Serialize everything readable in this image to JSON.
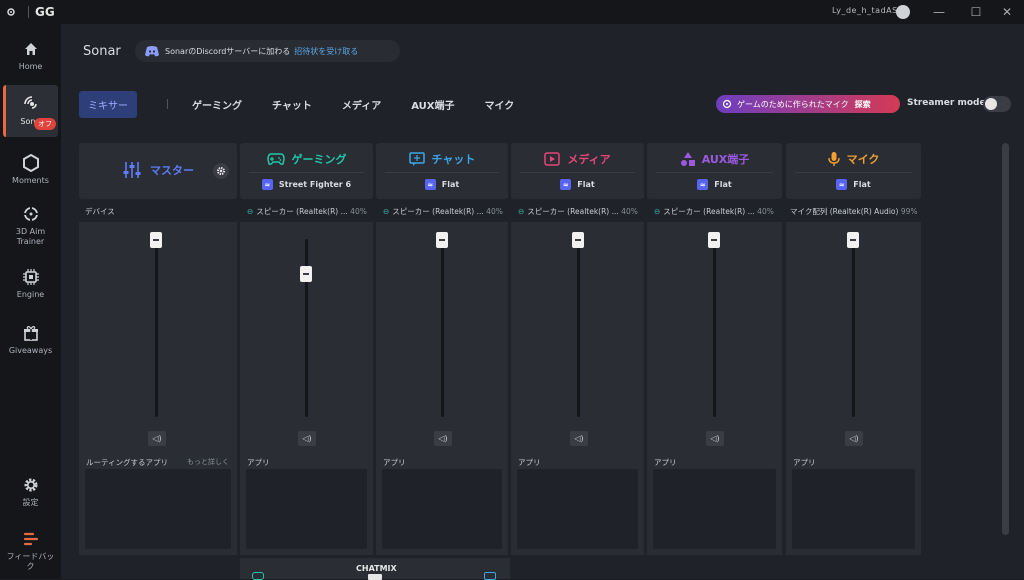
{
  "titlebar": {
    "app": "GG",
    "user": "Ly_de_h_tadAS"
  },
  "sidebar": {
    "items": [
      {
        "label": "Home",
        "icon": "home-icon"
      },
      {
        "label": "Sonar",
        "icon": "sonar-icon"
      },
      {
        "label": "Moments",
        "icon": "moments-icon"
      },
      {
        "label": "3D Aim Trainer",
        "icon": "aim-trainer-icon"
      },
      {
        "label": "Engine",
        "icon": "engine-icon"
      },
      {
        "label": "Giveaways",
        "icon": "gift-icon"
      },
      {
        "label": "設定",
        "icon": "gear-icon"
      },
      {
        "label": "フィードバック",
        "icon": "feedback-icon"
      }
    ],
    "moments_badge": "オフ"
  },
  "header": {
    "title": "Sonar",
    "discord_text": "SonarのDiscordサーバーに加わる",
    "discord_link": "招待状を受け取る"
  },
  "tabs": [
    {
      "label": "ミキサー"
    },
    {
      "label": "ゲーミング"
    },
    {
      "label": "チャット"
    },
    {
      "label": "メディア"
    },
    {
      "label": "AUX端子"
    },
    {
      "label": "マイク"
    }
  ],
  "explore": {
    "text": "ゲームのために作られたマイク",
    "action": "探索"
  },
  "streamer_mode": {
    "label": "Streamer mode",
    "enabled": false
  },
  "channels": [
    {
      "name": "マスター",
      "color": "#5c7cfa",
      "device_label": "デバイス",
      "apps_label": "ルーティングするアプリ",
      "apps_more": "もっと詳しく",
      "level": 1.0
    },
    {
      "name": "ゲーミング",
      "color": "#1fc9a8",
      "preset": "Street Fighter 6",
      "device": "スピーカー (Realtek(R) ...",
      "pct": "40%",
      "apps_label": "アプリ",
      "level": 0.81
    },
    {
      "name": "チャット",
      "color": "#3aa7e6",
      "preset": "Flat",
      "device": "スピーカー (Realtek(R) ...",
      "pct": "40%",
      "apps_label": "アプリ",
      "level": 1.0
    },
    {
      "name": "メディア",
      "color": "#e8457a",
      "preset": "Flat",
      "device": "スピーカー (Realtek(R) ...",
      "pct": "40%",
      "apps_label": "アプリ",
      "level": 1.0
    },
    {
      "name": "AUX端子",
      "color": "#9b59e0",
      "preset": "Flat",
      "device": "スピーカー (Realtek(R) ...",
      "pct": "40%",
      "apps_label": "アプリ",
      "level": 1.0
    },
    {
      "name": "マイク",
      "color": "#f0a030",
      "preset": "Flat",
      "device": "マイク配列 (Realtek(R) Audio)",
      "pct": "99%",
      "apps_label": "アプリ",
      "level": 1.0
    }
  ],
  "chatmix": {
    "label": "CHATMIX"
  }
}
